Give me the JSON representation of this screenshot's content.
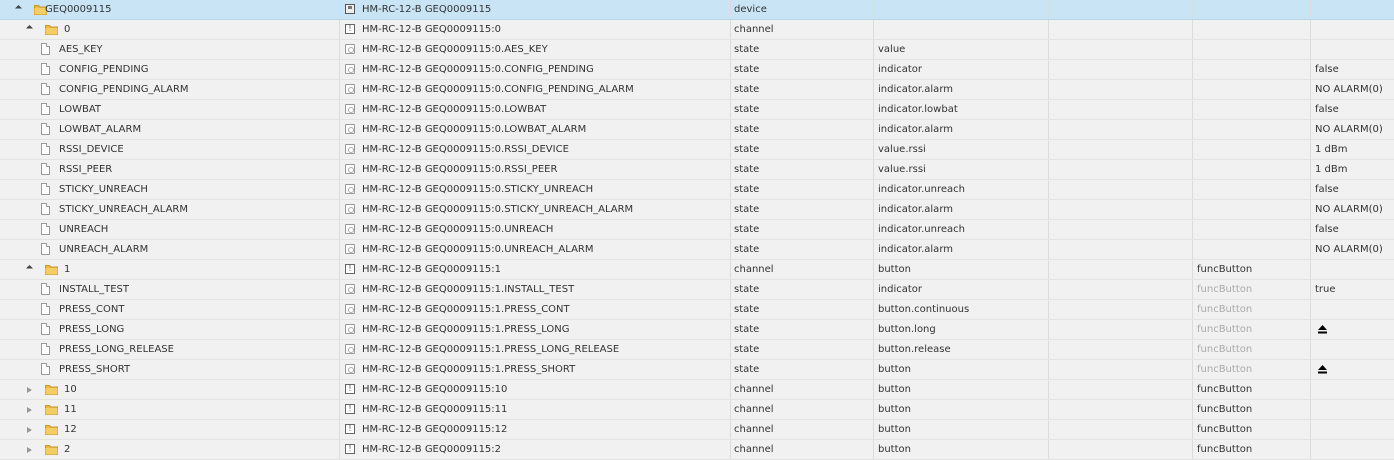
{
  "rows": [
    {
      "level": 0,
      "kind": "folder",
      "expand": "open",
      "name": "GEQ0009115",
      "id": "HM-RC-12-B GEQ0009115",
      "icon": "device-icon",
      "type": "device",
      "role": "",
      "func": "",
      "val": "",
      "selected": true
    },
    {
      "level": 1,
      "kind": "folder",
      "expand": "open",
      "name": "0",
      "id": "HM-RC-12-B GEQ0009115:0",
      "icon": "channel-icon",
      "type": "channel",
      "role": "",
      "func": "",
      "val": ""
    },
    {
      "level": 2,
      "kind": "file",
      "name": "AES_KEY",
      "id": "HM-RC-12-B GEQ0009115:0.AES_KEY",
      "icon": "state-icon",
      "type": "state",
      "role": "value",
      "func": "",
      "val": ""
    },
    {
      "level": 2,
      "kind": "file",
      "name": "CONFIG_PENDING",
      "id": "HM-RC-12-B GEQ0009115:0.CONFIG_PENDING",
      "icon": "state-icon",
      "type": "state",
      "role": "indicator",
      "func": "",
      "val": "false"
    },
    {
      "level": 2,
      "kind": "file",
      "name": "CONFIG_PENDING_ALARM",
      "id": "HM-RC-12-B GEQ0009115:0.CONFIG_PENDING_ALARM",
      "icon": "state-icon",
      "type": "state",
      "role": "indicator.alarm",
      "func": "",
      "val": "NO ALARM(0)"
    },
    {
      "level": 2,
      "kind": "file",
      "name": "LOWBAT",
      "id": "HM-RC-12-B GEQ0009115:0.LOWBAT",
      "icon": "state-icon",
      "type": "state",
      "role": "indicator.lowbat",
      "func": "",
      "val": "false"
    },
    {
      "level": 2,
      "kind": "file",
      "name": "LOWBAT_ALARM",
      "id": "HM-RC-12-B GEQ0009115:0.LOWBAT_ALARM",
      "icon": "state-icon",
      "type": "state",
      "role": "indicator.alarm",
      "func": "",
      "val": "NO ALARM(0)"
    },
    {
      "level": 2,
      "kind": "file",
      "name": "RSSI_DEVICE",
      "id": "HM-RC-12-B GEQ0009115:0.RSSI_DEVICE",
      "icon": "state-icon",
      "type": "state",
      "role": "value.rssi",
      "func": "",
      "val": "1 dBm"
    },
    {
      "level": 2,
      "kind": "file",
      "name": "RSSI_PEER",
      "id": "HM-RC-12-B GEQ0009115:0.RSSI_PEER",
      "icon": "state-icon",
      "type": "state",
      "role": "value.rssi",
      "func": "",
      "val": "1 dBm"
    },
    {
      "level": 2,
      "kind": "file",
      "name": "STICKY_UNREACH",
      "id": "HM-RC-12-B GEQ0009115:0.STICKY_UNREACH",
      "icon": "state-icon",
      "type": "state",
      "role": "indicator.unreach",
      "func": "",
      "val": "false"
    },
    {
      "level": 2,
      "kind": "file",
      "name": "STICKY_UNREACH_ALARM",
      "id": "HM-RC-12-B GEQ0009115:0.STICKY_UNREACH_ALARM",
      "icon": "state-icon",
      "type": "state",
      "role": "indicator.alarm",
      "func": "",
      "val": "NO ALARM(0)"
    },
    {
      "level": 2,
      "kind": "file",
      "name": "UNREACH",
      "id": "HM-RC-12-B GEQ0009115:0.UNREACH",
      "icon": "state-icon",
      "type": "state",
      "role": "indicator.unreach",
      "func": "",
      "val": "false"
    },
    {
      "level": 2,
      "kind": "file",
      "name": "UNREACH_ALARM",
      "id": "HM-RC-12-B GEQ0009115:0.UNREACH_ALARM",
      "icon": "state-icon",
      "type": "state",
      "role": "indicator.alarm",
      "func": "",
      "val": "NO ALARM(0)"
    },
    {
      "level": 1,
      "kind": "folder",
      "expand": "open",
      "name": "1",
      "id": "HM-RC-12-B GEQ0009115:1",
      "icon": "channel-icon",
      "type": "channel",
      "role": "button",
      "func": "funcButton",
      "funcDim": false,
      "val": ""
    },
    {
      "level": 2,
      "kind": "file",
      "name": "INSTALL_TEST",
      "id": "HM-RC-12-B GEQ0009115:1.INSTALL_TEST",
      "icon": "state-icon",
      "type": "state",
      "role": "indicator",
      "func": "funcButton",
      "funcDim": true,
      "val": "true"
    },
    {
      "level": 2,
      "kind": "file",
      "name": "PRESS_CONT",
      "id": "HM-RC-12-B GEQ0009115:1.PRESS_CONT",
      "icon": "state-icon",
      "type": "state",
      "role": "button.continuous",
      "func": "funcButton",
      "funcDim": true,
      "val": ""
    },
    {
      "level": 2,
      "kind": "file",
      "name": "PRESS_LONG",
      "id": "HM-RC-12-B GEQ0009115:1.PRESS_LONG",
      "icon": "state-icon",
      "type": "state",
      "role": "button.long",
      "func": "funcButton",
      "funcDim": true,
      "val": "",
      "valIcon": "eject-button-icon"
    },
    {
      "level": 2,
      "kind": "file",
      "name": "PRESS_LONG_RELEASE",
      "id": "HM-RC-12-B GEQ0009115:1.PRESS_LONG_RELEASE",
      "icon": "state-icon",
      "type": "state",
      "role": "button.release",
      "func": "funcButton",
      "funcDim": true,
      "val": ""
    },
    {
      "level": 2,
      "kind": "file",
      "name": "PRESS_SHORT",
      "id": "HM-RC-12-B GEQ0009115:1.PRESS_SHORT",
      "icon": "state-icon",
      "type": "state",
      "role": "button",
      "func": "funcButton",
      "funcDim": true,
      "val": "",
      "valIcon": "eject-button-icon"
    },
    {
      "level": 1,
      "kind": "folder",
      "expand": "closed",
      "name": "10",
      "id": "HM-RC-12-B GEQ0009115:10",
      "icon": "channel-icon",
      "type": "channel",
      "role": "button",
      "func": "funcButton",
      "funcDim": false,
      "val": ""
    },
    {
      "level": 1,
      "kind": "folder",
      "expand": "closed",
      "name": "11",
      "id": "HM-RC-12-B GEQ0009115:11",
      "icon": "channel-icon",
      "type": "channel",
      "role": "button",
      "func": "funcButton",
      "funcDim": false,
      "val": ""
    },
    {
      "level": 1,
      "kind": "folder",
      "expand": "closed",
      "name": "12",
      "id": "HM-RC-12-B GEQ0009115:12",
      "icon": "channel-icon",
      "type": "channel",
      "role": "button",
      "func": "funcButton",
      "funcDim": false,
      "val": ""
    },
    {
      "level": 1,
      "kind": "folder",
      "expand": "closed",
      "name": "2",
      "id": "HM-RC-12-B GEQ0009115:2",
      "icon": "channel-icon",
      "type": "channel",
      "role": "button",
      "func": "funcButton",
      "funcDim": false,
      "val": ""
    }
  ]
}
